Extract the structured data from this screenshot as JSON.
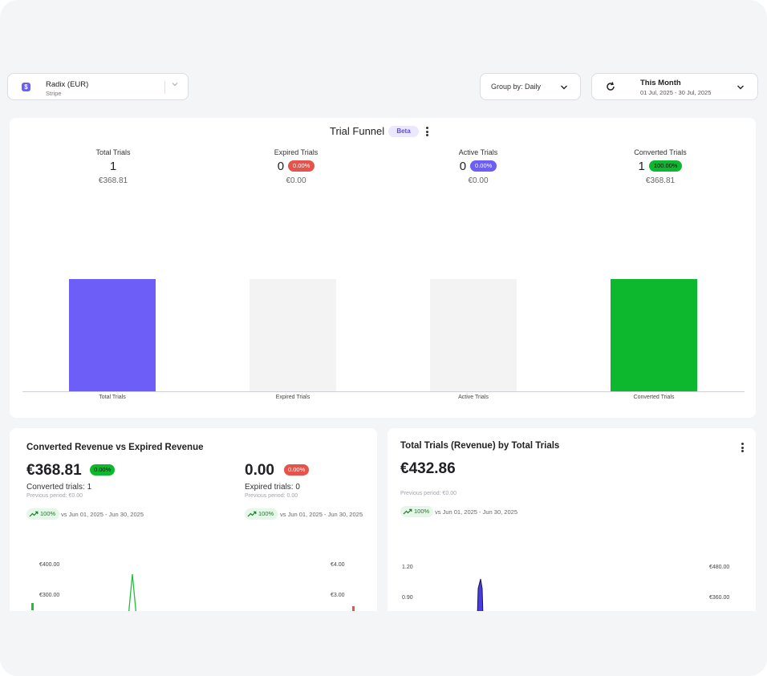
{
  "source": {
    "name": "Radix (EUR)",
    "provider": "Stripe",
    "logo": "$"
  },
  "group_by": {
    "label": "Group by: Daily"
  },
  "period": {
    "title": "This Month",
    "range": "01 Jul, 2025 - 30 Jul, 2025"
  },
  "funnel": {
    "title": "Trial Funnel",
    "badge": "Beta",
    "stats": [
      {
        "label": "Total Trials",
        "count": "1",
        "pct": "",
        "amount": "€368.81"
      },
      {
        "label": "Expired Trials",
        "count": "0",
        "pct": "0.00%",
        "amount": "€0.00"
      },
      {
        "label": "Active Trials",
        "count": "0",
        "pct": "0.00%",
        "amount": "€0.00"
      },
      {
        "label": "Converted Trials",
        "count": "1",
        "pct": "100.00%",
        "amount": "€368.81"
      }
    ],
    "colors": {
      "total": "#6c5ef7",
      "empty": "#f3f3f4",
      "converted": "#0db82e",
      "expired_pill": "#e5534b",
      "active_pill": "#6c5ef7",
      "converted_pill": "#0db82e"
    }
  },
  "chart_data": {
    "type": "bar",
    "categories": [
      "Total Trials",
      "Expired Trials",
      "Active Trials",
      "Converted Trials"
    ],
    "values": [
      1,
      0,
      0,
      1
    ]
  },
  "converted_vs_expired": {
    "title": "Converted Revenue vs Expired Revenue",
    "converted": {
      "value": "€368.81",
      "pct": "0.00%",
      "label": "Converted trials: 1",
      "previous": "Previous period: €0.00",
      "trend": "100%",
      "vs": "vs Jun 01, 2025 - Jun 30, 2025"
    },
    "expired": {
      "value": "0.00",
      "pct": "0.00%",
      "label": "Expired trials: 0",
      "previous": "Previous period: 0.00",
      "trend": "100%",
      "vs": "vs Jun 01, 2025 - Jun 30, 2025"
    },
    "left_ticks": [
      "€400.00",
      "€300.00"
    ],
    "right_ticks": [
      "€4.00",
      "€3.00"
    ]
  },
  "total_trials_revenue": {
    "title": "Total Trials (Revenue) by Total Trials",
    "value": "€432.86",
    "previous": "Previous period: €0.00",
    "trend": "100%",
    "vs": "vs Jun 01, 2025 - Jun 30, 2025",
    "left_ticks": [
      "1.20",
      "0.90"
    ],
    "right_ticks": [
      "€480.00",
      "€360.00"
    ]
  }
}
